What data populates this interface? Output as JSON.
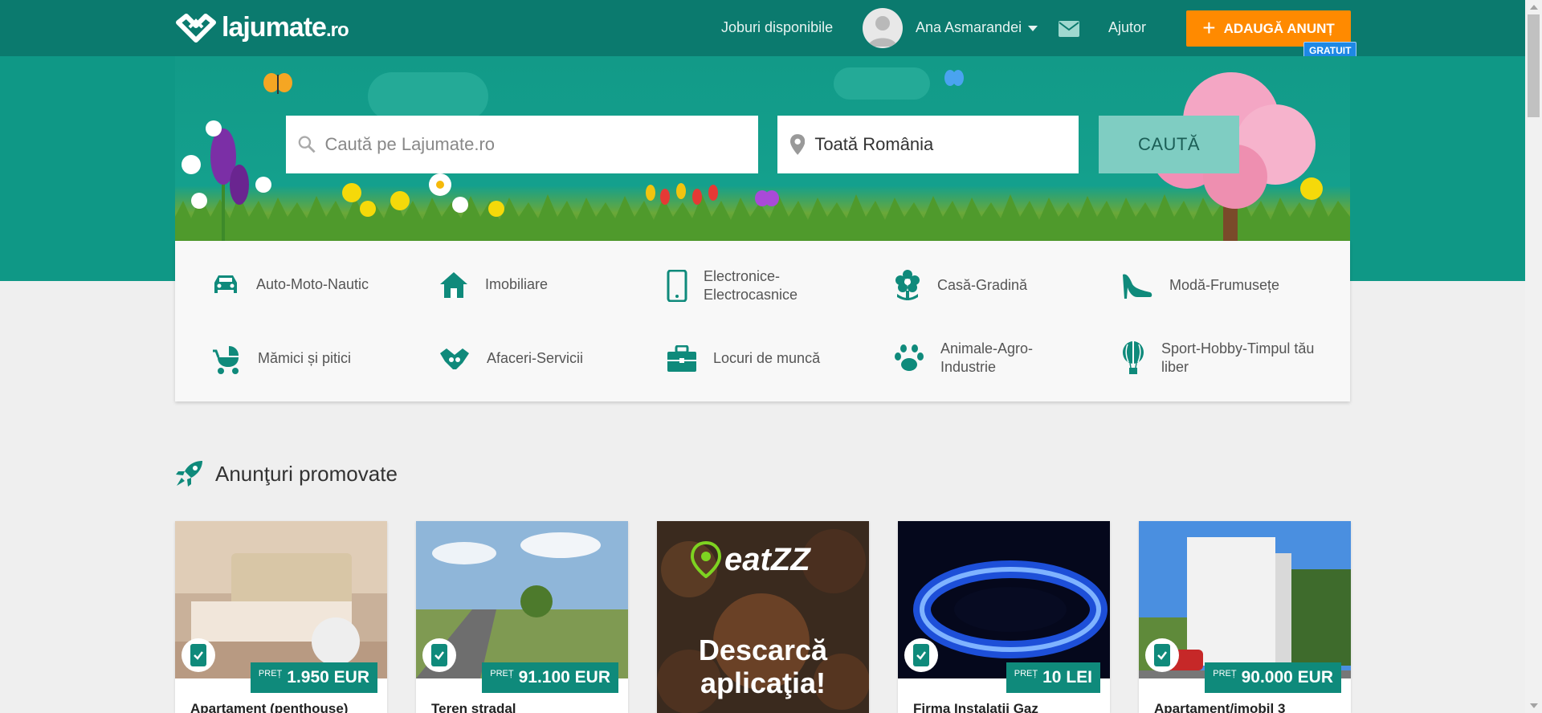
{
  "header": {
    "logo_main": "lajumate",
    "logo_suffix": ".ro",
    "jobs_link": "Joburi disponibile",
    "user_name": "Ana Asmarandei",
    "help_link": "Ajutor",
    "add_button": "ADAUGĂ ANUNȚ",
    "free_badge": "GRATUIT"
  },
  "search": {
    "query_placeholder": "Caută pe Lajumate.ro",
    "location_value": "Toată România",
    "button_label": "CAUTĂ"
  },
  "categories": [
    {
      "label": "Auto-Moto-Nautic",
      "icon": "car-icon"
    },
    {
      "label": "Imobiliare",
      "icon": "house-icon"
    },
    {
      "label": "Electronice-Electrocasnice",
      "icon": "phone-icon"
    },
    {
      "label": "Casă-Gradină",
      "icon": "flower-icon"
    },
    {
      "label": "Modă-Frumusețe",
      "icon": "high-heel-icon"
    },
    {
      "label": "Mămici și pitici",
      "icon": "stroller-icon"
    },
    {
      "label": "Afaceri-Servicii",
      "icon": "handshake-icon"
    },
    {
      "label": "Locuri de muncă",
      "icon": "briefcase-icon"
    },
    {
      "label": "Animale-Agro-Industrie",
      "icon": "paw-icon"
    },
    {
      "label": "Sport-Hobby-Timpul tău liber",
      "icon": "balloon-icon"
    }
  ],
  "promoted": {
    "title": "Anunţuri promovate",
    "price_label": "PREȚ",
    "cards": [
      {
        "title": "Apartament (penthouse)",
        "price": "1.950 EUR"
      },
      {
        "title": "Teren stradal",
        "price": "91.100 EUR"
      },
      {
        "brand": "eatZZ",
        "promo_text_1": "Descarcă",
        "promo_text_2": "aplicaţia!"
      },
      {
        "title": "Firma Instalatii Gaz",
        "price": "10 LEI"
      },
      {
        "title": "Apartament/imobil 3",
        "price": "90.000 EUR"
      }
    ]
  },
  "colors": {
    "header_bg": "#0b7a6e",
    "hero_bg": "#0f9886",
    "accent_orange": "#ff8a00",
    "accent_teal": "#0f8a7b",
    "free_badge_blue": "#1e88e5"
  }
}
